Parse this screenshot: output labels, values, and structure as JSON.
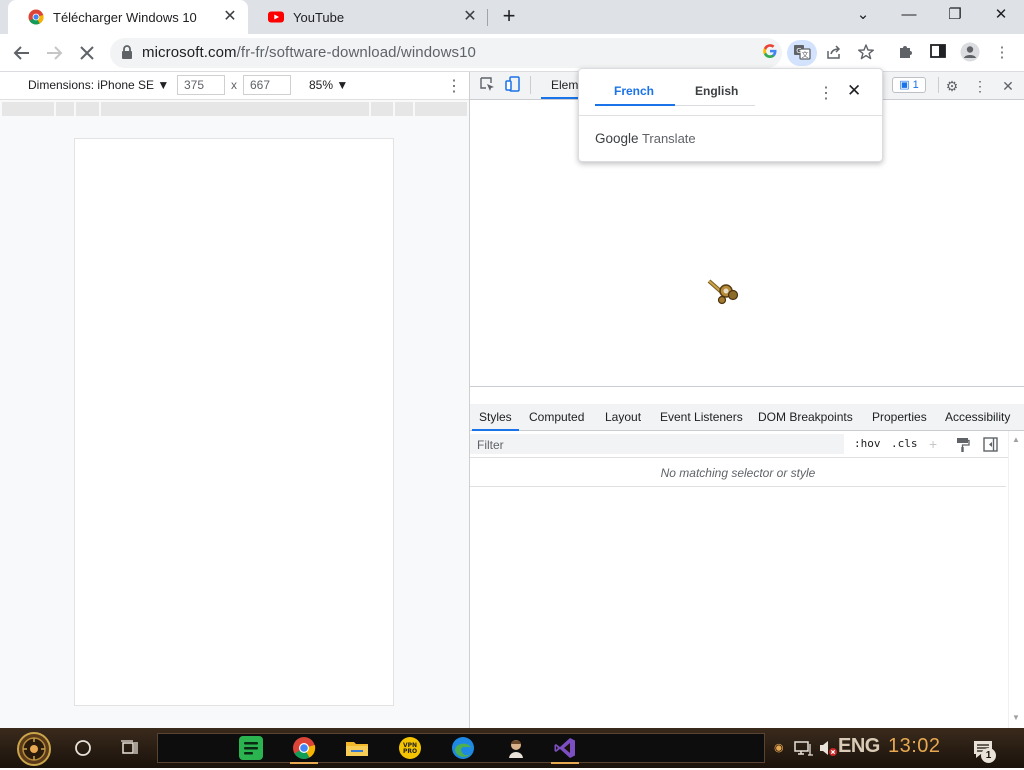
{
  "browser": {
    "tabs": [
      {
        "title": "Télécharger Windows 10",
        "icon": "chrome-favicon",
        "active": true
      },
      {
        "title": "YouTube",
        "icon": "youtube-favicon",
        "active": false
      }
    ],
    "url_domain": "microsoft.com",
    "url_path": "/fr-fr/software-download/windows10",
    "window_controls": {
      "collapse": "⌄",
      "minimize": "—",
      "restore": "❐",
      "close": "✕"
    }
  },
  "device_toolbar": {
    "dimensions_label": "Dimensions: iPhone SE ▼",
    "width": "375",
    "x_sep": "x",
    "height": "667",
    "zoom": "85% ▼"
  },
  "devtools": {
    "elements_tab": "Eleme",
    "issues_count": "1",
    "style_tabs": [
      "Styles",
      "Computed",
      "Layout",
      "Event Listeners",
      "DOM Breakpoints",
      "Properties",
      "Accessibility"
    ],
    "filter_placeholder": "Filter",
    "hov": ":hov",
    "cls": ".cls",
    "no_match": "No matching selector or style"
  },
  "translate_popup": {
    "source_lang": "French",
    "target_lang": "English",
    "brand_google": "Google",
    "brand_translate": "Translate"
  },
  "taskbar": {
    "language": "ENG",
    "time": "13:02",
    "notification_count": "1"
  },
  "colors": {
    "accent": "#1a73e8",
    "tabstrip": "#dee1e6",
    "clock": "#e8a851"
  }
}
